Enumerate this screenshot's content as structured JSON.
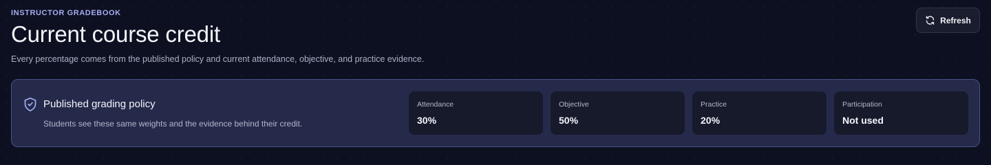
{
  "header": {
    "eyebrow": "INSTRUCTOR GRADEBOOK",
    "title": "Current course credit",
    "subtitle": "Every percentage comes from the published policy and current attendance, objective, and practice evidence."
  },
  "toolbar": {
    "refresh_label": "Refresh",
    "refresh_icon": "refresh-icon"
  },
  "policy": {
    "icon": "shield-check-icon",
    "title": "Published grading policy",
    "description": "Students see these same weights and the evidence behind their credit.",
    "weights": [
      {
        "label": "Attendance",
        "value": "30%"
      },
      {
        "label": "Objective",
        "value": "50%"
      },
      {
        "label": "Practice",
        "value": "20%"
      },
      {
        "label": "Participation",
        "value": "Not used"
      }
    ]
  },
  "colors": {
    "background": "#0d1020",
    "accent": "#a5adf2",
    "card": "#252a4b",
    "card_border": "#4a5184",
    "tile": "#171a2b"
  }
}
